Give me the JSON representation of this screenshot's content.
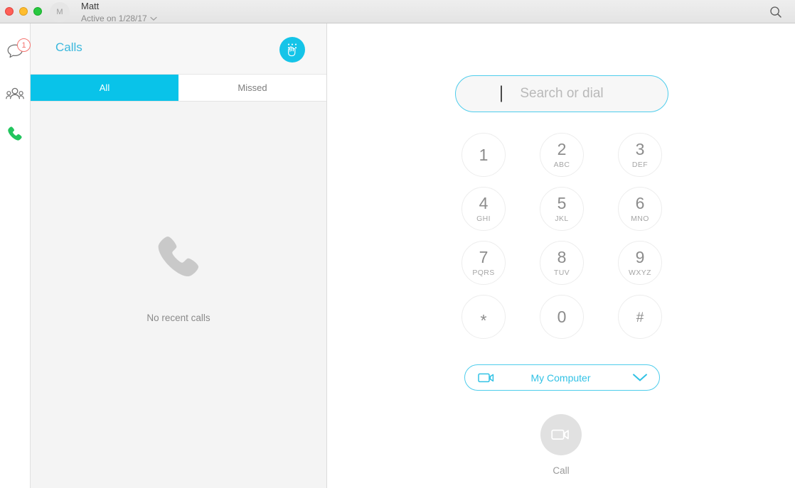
{
  "titlebar": {
    "traffic_lights": [
      "close",
      "minimize",
      "maximize"
    ],
    "avatar_initial": "M",
    "user_name": "Matt",
    "user_status": "Active on 1/28/17",
    "search_icon": "search-icon"
  },
  "rail": {
    "items": [
      {
        "name": "chat",
        "icon": "chat-bubble-icon",
        "badge": "1",
        "active": false
      },
      {
        "name": "contacts",
        "icon": "contacts-group-icon",
        "badge": "",
        "active": false
      },
      {
        "name": "calls",
        "icon": "phone-handset-icon",
        "badge": "",
        "active": true
      }
    ]
  },
  "calls_panel": {
    "title": "Calls",
    "dialpad_button_icon": "dialpad-hand-icon",
    "tabs": [
      {
        "label": "All",
        "active": true
      },
      {
        "label": "Missed",
        "active": false
      }
    ],
    "empty_state": {
      "icon": "phone-handset-icon",
      "text": "No recent calls"
    }
  },
  "dial_panel": {
    "search": {
      "placeholder": "Search or dial",
      "value": ""
    },
    "keypad": [
      [
        {
          "digit": "1",
          "letters": ""
        },
        {
          "digit": "2",
          "letters": "ABC"
        },
        {
          "digit": "3",
          "letters": "DEF"
        }
      ],
      [
        {
          "digit": "4",
          "letters": "GHI"
        },
        {
          "digit": "5",
          "letters": "JKL"
        },
        {
          "digit": "6",
          "letters": "MNO"
        }
      ],
      [
        {
          "digit": "7",
          "letters": "PQRS"
        },
        {
          "digit": "8",
          "letters": "TUV"
        },
        {
          "digit": "9",
          "letters": "WXYZ"
        }
      ],
      [
        {
          "digit": "*",
          "letters": ""
        },
        {
          "digit": "0",
          "letters": ""
        },
        {
          "digit": "#",
          "letters": ""
        }
      ]
    ],
    "device_select": {
      "icon": "video-camera-icon",
      "label": "My Computer",
      "chevron": "chevron-down-icon"
    },
    "call": {
      "icon": "video-camera-icon",
      "label": "Call",
      "enabled": false
    }
  },
  "colors": {
    "accent_cyan": "#09c3e9",
    "accent_cyan_border": "#4ecdec",
    "title_cyan": "#3bb8dd",
    "badge_red": "#f4736f",
    "phone_green": "#22c55e",
    "panel_gray": "#f4f4f4",
    "disabled_gray": "#e1e1e1"
  }
}
